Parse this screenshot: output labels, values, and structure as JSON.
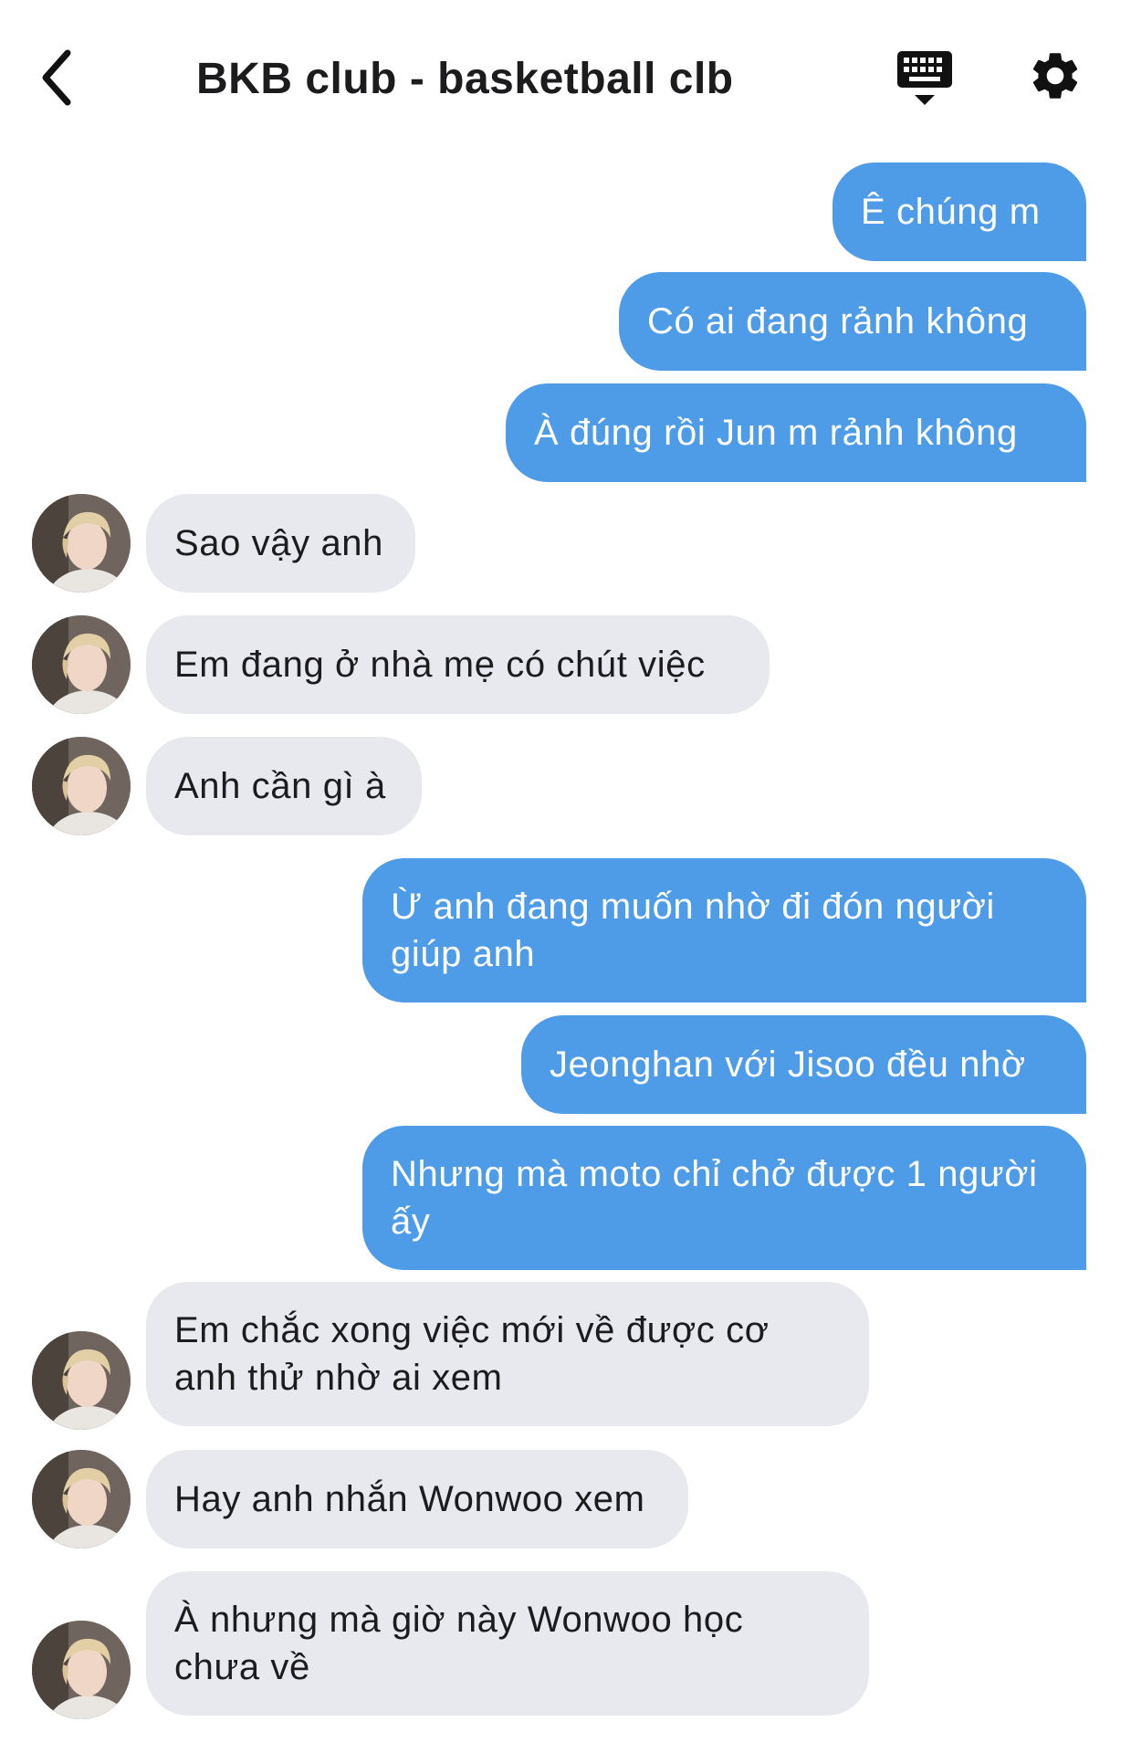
{
  "header": {
    "title": "BKB club - basketball clb",
    "back_icon": "chevron-left-icon",
    "keyboard_icon": "keyboard-icon",
    "settings_icon": "gear-icon"
  },
  "colors": {
    "outgoing_bubble": "#4e9ce8",
    "incoming_bubble": "#e8e9ee",
    "text_dark": "#1c1c1e"
  },
  "messages": [
    {
      "dir": "out",
      "text": "Ê chúng m"
    },
    {
      "dir": "out",
      "text": "Có ai đang rảnh không"
    },
    {
      "dir": "out",
      "text": "À đúng rồi Jun m rảnh không"
    },
    {
      "dir": "in",
      "text": "Sao vậy anh"
    },
    {
      "dir": "in",
      "text": "Em đang ở nhà mẹ có chút việc"
    },
    {
      "dir": "in",
      "text": "Anh cần gì à"
    },
    {
      "dir": "out",
      "lines": [
        "Ừ anh đang muốn nhờ đi đón người",
        "giúp anh"
      ]
    },
    {
      "dir": "out",
      "text": "Jeonghan với Jisoo đều nhờ"
    },
    {
      "dir": "out",
      "lines": [
        "Nhưng mà moto chỉ chở được 1 người",
        "ấy"
      ]
    },
    {
      "dir": "in",
      "lines": [
        "Em chắc xong việc mới về được cơ",
        "anh thử nhờ ai xem"
      ]
    },
    {
      "dir": "in",
      "text": "Hay anh nhắn Wonwoo xem"
    },
    {
      "dir": "in",
      "lines": [
        "À nhưng mà giờ này Wonwoo học",
        "chưa về"
      ]
    }
  ]
}
